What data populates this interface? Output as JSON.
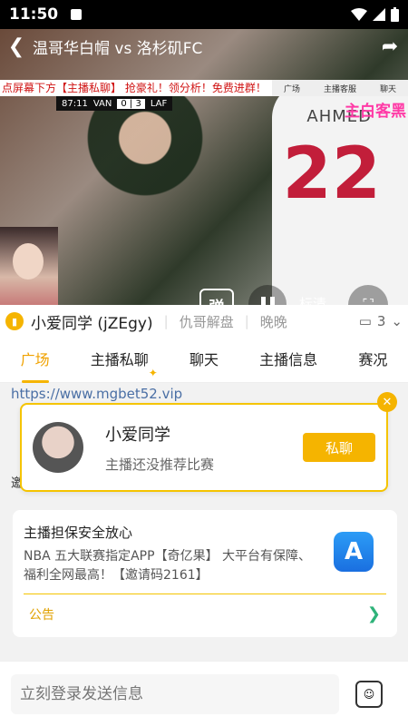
{
  "status_bar": {
    "time": "11:50"
  },
  "video": {
    "title": "温哥华白帽 vs 洛杉矶FC",
    "ticker": "点屏幕下方【主播私聊】 抢豪礼！领分析！免费进群！",
    "banner_items": [
      "广场",
      "主播客服",
      "聊天"
    ],
    "scoreboard": {
      "time": "87:11",
      "home": "VAN",
      "score": "0 | 3",
      "away": "LAF"
    },
    "overlay_text": "主白客黑",
    "jersey_name": "AHMED",
    "jersey_number": "22",
    "danmu_label": "弹",
    "quality_label": "标清"
  },
  "anchor_bar": {
    "name": "小爱同学 (jZEgy)",
    "tags": [
      "仇哥解盘",
      "晚晚"
    ],
    "viewer_count": "3"
  },
  "tabs": [
    {
      "label": "广场",
      "active": true
    },
    {
      "label": "主播私聊",
      "badge": "✦"
    },
    {
      "label": "聊天"
    },
    {
      "label": "主播信息"
    },
    {
      "label": "赛况"
    }
  ],
  "feed": {
    "url_text": "https://www.mgbet52.vip",
    "hidden_text": "邀"
  },
  "recommend_card": {
    "name": "小爱同学",
    "desc": "主播还没推荐比赛",
    "button": "私聊"
  },
  "notice": {
    "title": "主播担保安全放心",
    "body": "NBA 五大联赛指定APP【奇亿果】 大平台有保障、福利全网最高！【邀请码2161】",
    "footer_label": "公告"
  },
  "input": {
    "placeholder": "立刻登录发送信息"
  },
  "colors": {
    "accent": "#f5b400",
    "ticker_red": "#d01414",
    "overlay_pink": "#ff3aa6"
  }
}
